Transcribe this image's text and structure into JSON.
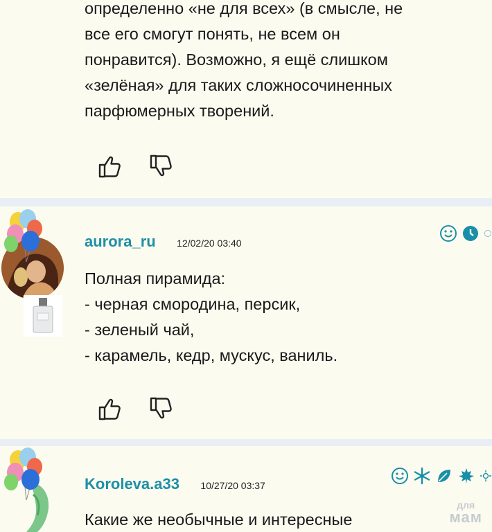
{
  "posts": [
    {
      "lines": [
        "определенно «не для всех» (в смысле, не",
        "все его смогут понять, не всем он",
        "понравится). Возможно, я ещё слишком",
        "«зелёная» для таких сложносочиненных",
        "парфюмерных творений."
      ]
    },
    {
      "username": "aurora_ru",
      "date": "12/02/20 03:40",
      "lines": [
        "Полная пирамида:",
        "- черная смородина, персик,",
        "- зеленый чай,",
        "- карамель, кедр, мускус, ваниль."
      ]
    },
    {
      "username": "Koroleva.a33",
      "date": "10/27/20 03:37",
      "lines": [
        "Какие же необычные и интересные"
      ]
    }
  ],
  "watermark": {
    "top": "для",
    "bottom": "мам"
  },
  "colors": {
    "username": "#1f8fa6",
    "post_bg": "#fbfbf0",
    "separator": "#e8eef3",
    "icon": "#1a8fa8"
  }
}
